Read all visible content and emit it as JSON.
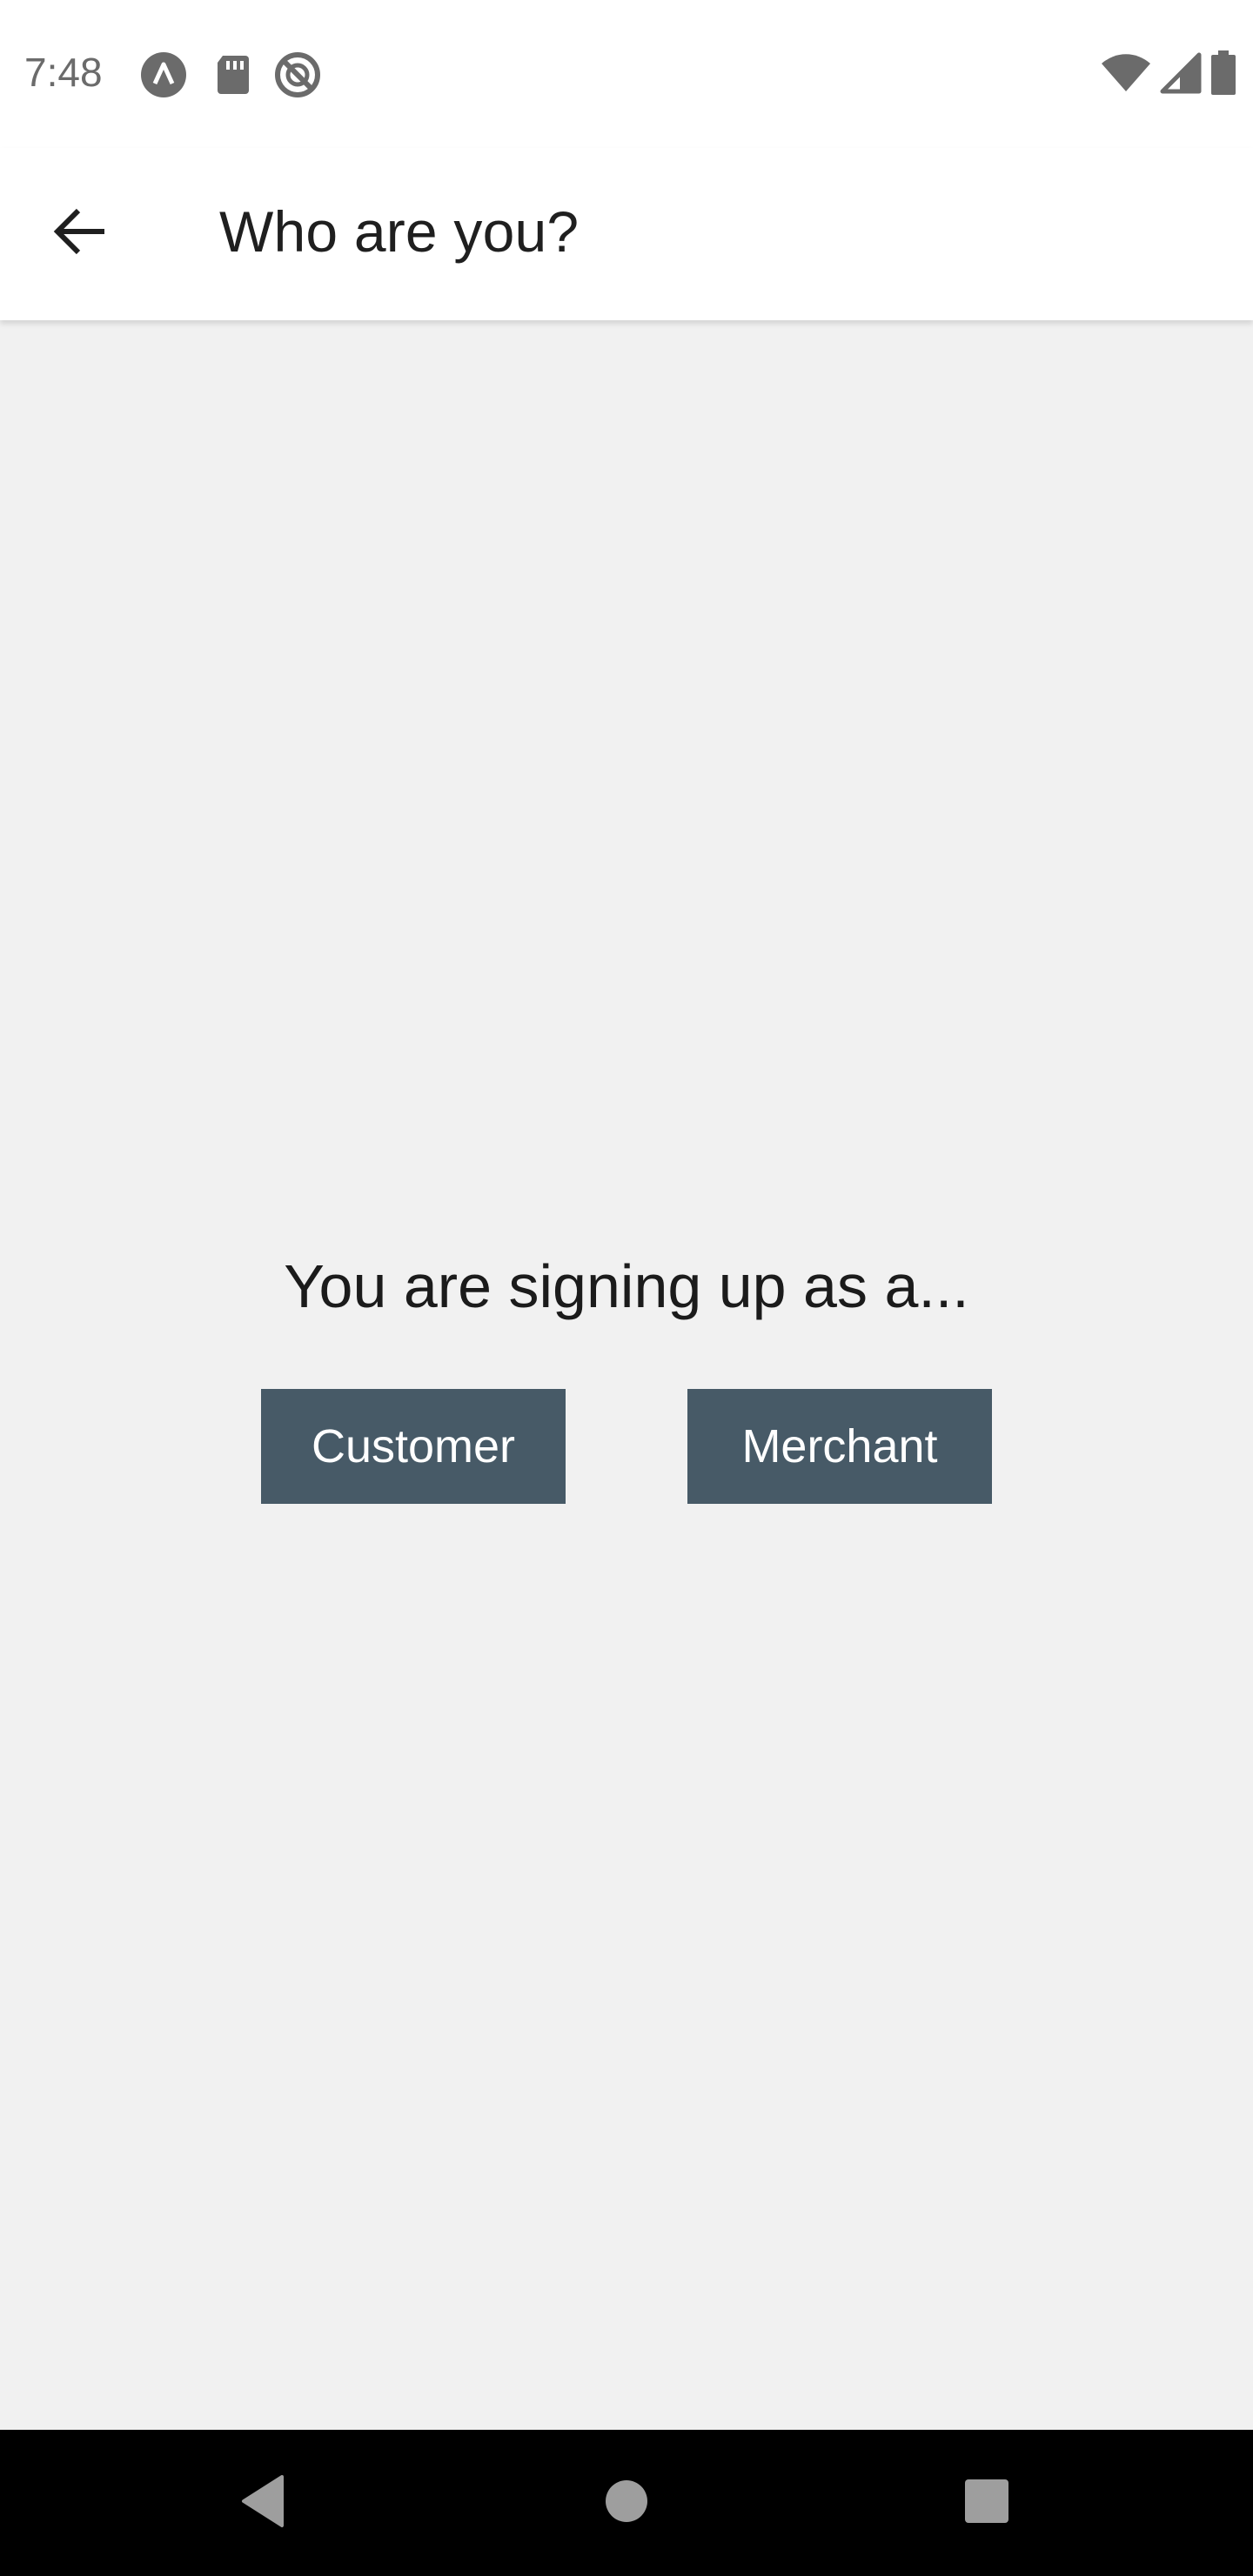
{
  "status_bar": {
    "time": "7:48",
    "left_icons": [
      "autofill-icon",
      "sd-card-icon",
      "no-disturb-icon"
    ],
    "right_icons": [
      "wifi-icon",
      "signal-icon",
      "battery-icon"
    ]
  },
  "app_bar": {
    "title": "Who are you?",
    "back_icon": "arrow-back-icon"
  },
  "main": {
    "prompt": "You are signing up as a...",
    "buttons": {
      "customer_label": "Customer",
      "merchant_label": "Merchant"
    }
  },
  "nav_bar": {
    "icons": [
      "back-triangle-icon",
      "home-circle-icon",
      "recents-square-icon"
    ]
  },
  "colors": {
    "button_bg": "#475a67",
    "page_bg": "#f1f1f1",
    "app_bar_bg": "#ffffff",
    "nav_bar_bg": "#000000"
  }
}
